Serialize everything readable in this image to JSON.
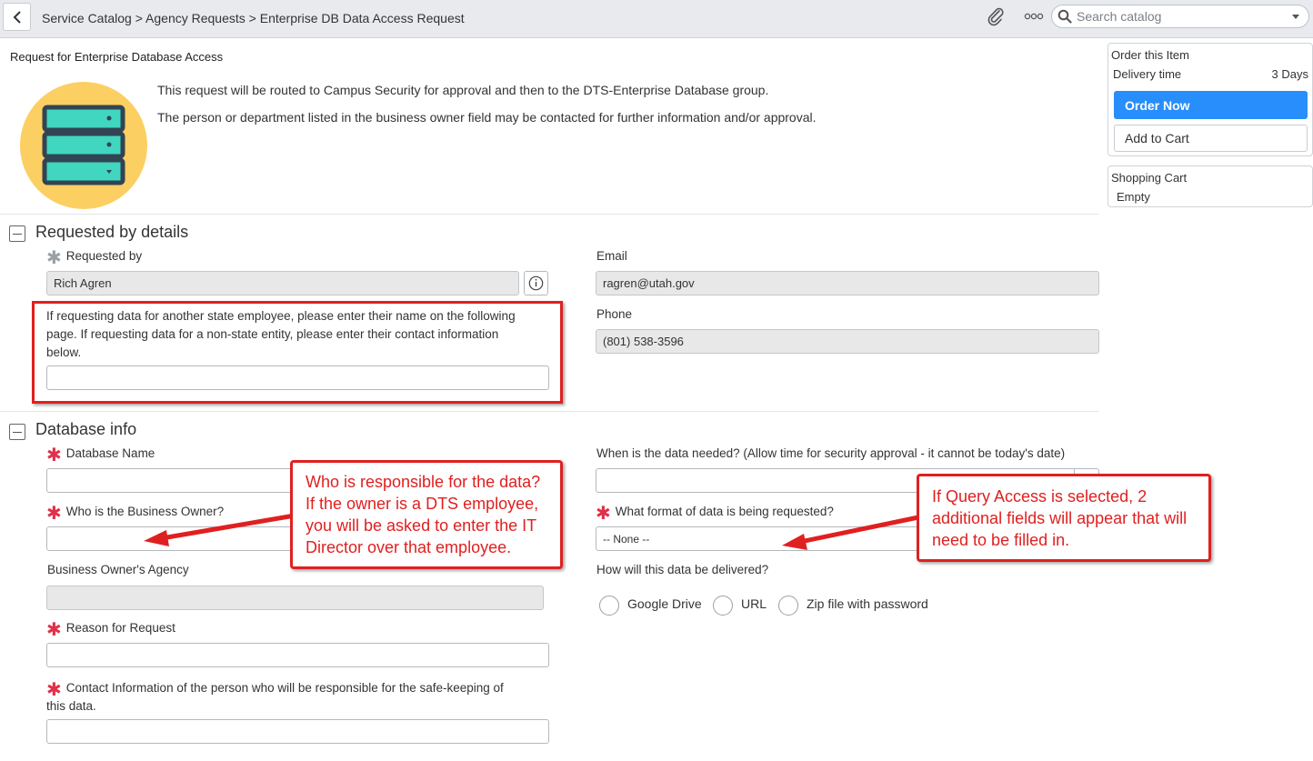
{
  "breadcrumb": {
    "items": [
      "Service Catalog",
      "Agency Requests",
      "Enterprise DB Data Access Request"
    ],
    "separator": ">"
  },
  "search": {
    "placeholder": "Search catalog"
  },
  "request": {
    "title": "Request for Enterprise Database Access",
    "intro_line_1": "This request will be routed to Campus Security for approval and then to the DTS-Enterprise Database group.",
    "intro_line_2": "The person or department listed in the business owner field may be contacted for further information and/or approval."
  },
  "requested_by_section": {
    "title": "Requested by details",
    "requested_by_label": "Requested by",
    "requested_by_value": "Rich Agren",
    "email_label": "Email",
    "email_value": "ragren@utah.gov",
    "phone_label": "Phone",
    "phone_value": "(801) 538-3596",
    "other_employee_label_1": "If requesting data for another state employee, please enter their name on the following",
    "other_employee_label_2": "page. If requesting data for a non-state entity, please enter their contact information",
    "other_employee_label_3": "below."
  },
  "database_section": {
    "title": "Database info",
    "database_name_label": "Database Name",
    "business_owner_label": "Who is the Business Owner?",
    "owner_agency_label": "Business Owner's Agency",
    "reason_label": "Reason for Request",
    "contact_label_1": "Contact Information of the person who will be responsible for the safe-keeping of",
    "contact_label_2": "this data.",
    "when_needed_label": "When is the data needed? (Allow time for security approval - it cannot be today's date)",
    "format_label": "What format of data is being requested?",
    "format_value": "-- None --",
    "delivery_label": "How will this data be delivered?",
    "delivery_options": [
      "Google Drive",
      "URL",
      "Zip file with password"
    ]
  },
  "order_panel": {
    "title": "Order this Item",
    "delivery_label": "Delivery time",
    "delivery_value": "3 Days",
    "order_now": "Order Now",
    "add_to_cart": "Add to Cart"
  },
  "cart_panel": {
    "title": "Shopping Cart",
    "status": "Empty"
  },
  "callouts": {
    "owner_1": "Who is responsible for the data?",
    "owner_2": "If the owner is a DTS employee,",
    "owner_3": "you will be asked to enter the IT",
    "owner_4": "Director over that employee.",
    "query_1": "If Query Access is selected, 2",
    "query_2": "additional fields will appear that will",
    "query_3": "need to be filled in."
  },
  "colors": {
    "primary_button": "#278efc",
    "annotation_red": "#e02020",
    "mandatory": "#e0304a",
    "header_bg": "#e8eaed"
  },
  "icons": [
    "chevron-left-icon",
    "paperclip-icon",
    "more-icon",
    "search-icon",
    "dropdown-caret-icon",
    "database-server-icon",
    "info-icon",
    "collapse-icon",
    "mandatory-asterisk-icon"
  ]
}
